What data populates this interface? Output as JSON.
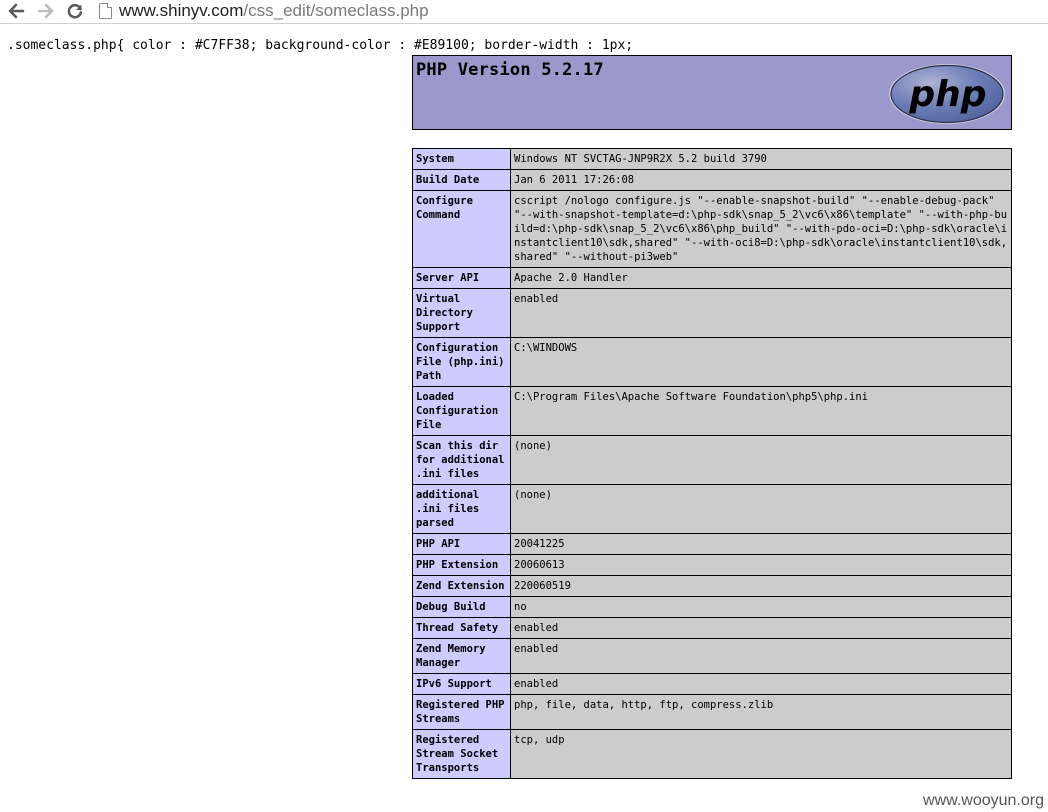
{
  "browser": {
    "back_icon": "arrow-left-icon",
    "forward_icon": "arrow-right-icon",
    "reload_icon": "reload-icon",
    "url_domain": "www.shinyv.com",
    "url_path": "/css_edit/someclass.php"
  },
  "css_line": ".someclass.php{ color : #C7FF38; background-color : #E89100; border-width : 1px;",
  "phpinfo": {
    "title": "PHP Version 5.2.17",
    "logo_text": "php",
    "rows": [
      {
        "label": "System",
        "value": "Windows NT SVCTAG-JNP9R2X 5.2 build 3790"
      },
      {
        "label": "Build Date",
        "value": "Jan 6 2011 17:26:08"
      },
      {
        "label": "Configure Command",
        "value": "cscript /nologo configure.js \"--enable-snapshot-build\" \"--enable-debug-pack\" \"--with-snapshot-template=d:\\php-sdk\\snap_5_2\\vc6\\x86\\template\" \"--with-php-build=d:\\php-sdk\\snap_5_2\\vc6\\x86\\php_build\" \"--with-pdo-oci=D:\\php-sdk\\oracle\\instantclient10\\sdk,shared\" \"--with-oci8=D:\\php-sdk\\oracle\\instantclient10\\sdk,shared\" \"--without-pi3web\""
      },
      {
        "label": "Server API",
        "value": "Apache 2.0 Handler"
      },
      {
        "label": "Virtual Directory Support",
        "value": "enabled"
      },
      {
        "label": "Configuration File (php.ini) Path",
        "value": "C:\\WINDOWS"
      },
      {
        "label": "Loaded Configuration File",
        "value": "C:\\Program Files\\Apache Software Foundation\\php5\\php.ini"
      },
      {
        "label": "Scan this dir for additional .ini files",
        "value": "(none)"
      },
      {
        "label": "additional .ini files parsed",
        "value": "(none)"
      },
      {
        "label": "PHP API",
        "value": "20041225"
      },
      {
        "label": "PHP Extension",
        "value": "20060613"
      },
      {
        "label": "Zend Extension",
        "value": "220060519"
      },
      {
        "label": "Debug Build",
        "value": "no"
      },
      {
        "label": "Thread Safety",
        "value": "enabled"
      },
      {
        "label": "Zend Memory Manager",
        "value": "enabled"
      },
      {
        "label": "IPv6 Support",
        "value": "enabled"
      },
      {
        "label": "Registered PHP Streams",
        "value": "php, file, data, http, ftp, compress.zlib"
      },
      {
        "label": "Registered Stream Socket Transports",
        "value": "tcp, udp"
      }
    ]
  },
  "watermark": "www.wooyun.org",
  "colors": {
    "header_bg": "#9999cc",
    "label_bg": "#ccccff",
    "value_bg": "#cccccc",
    "logo_bg": "#6c7eb7"
  }
}
